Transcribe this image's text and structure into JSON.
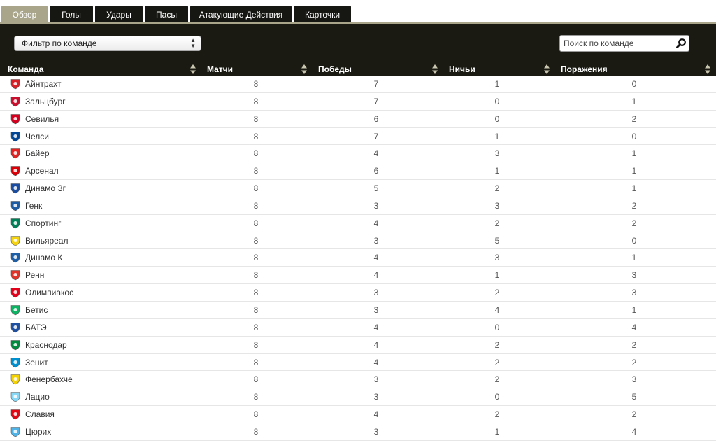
{
  "tabs": [
    {
      "label": "Обзор",
      "active": true
    },
    {
      "label": "Голы",
      "active": false
    },
    {
      "label": "Удары",
      "active": false
    },
    {
      "label": "Пасы",
      "active": false
    },
    {
      "label": "Атакующие Действия",
      "active": false
    },
    {
      "label": "Карточки",
      "active": false
    }
  ],
  "filter": {
    "label": "Фильтр по команде"
  },
  "search": {
    "placeholder": "Поиск по команде",
    "icon": "search-icon"
  },
  "columns": [
    "Команда",
    "Матчи",
    "Победы",
    "Ничьи",
    "Поражения"
  ],
  "colors": {
    "tab_active": "#a9a58a",
    "tab_bg": "#161612",
    "header_bg": "#1a1a12"
  },
  "rows": [
    {
      "team": "Айнтрахт",
      "matches": "8",
      "wins": "7",
      "draws": "1",
      "losses": "0",
      "crest_color": "#d81f26"
    },
    {
      "team": "Зальцбург",
      "matches": "8",
      "wins": "7",
      "draws": "0",
      "losses": "1",
      "crest_color": "#c8102e"
    },
    {
      "team": "Севилья",
      "matches": "8",
      "wins": "6",
      "draws": "0",
      "losses": "2",
      "crest_color": "#d5001f"
    },
    {
      "team": "Челси",
      "matches": "8",
      "wins": "7",
      "draws": "1",
      "losses": "0",
      "crest_color": "#034694"
    },
    {
      "team": "Байер",
      "matches": "8",
      "wins": "4",
      "draws": "3",
      "losses": "1",
      "crest_color": "#e32221"
    },
    {
      "team": "Арсенал",
      "matches": "8",
      "wins": "6",
      "draws": "1",
      "losses": "1",
      "crest_color": "#db0007"
    },
    {
      "team": "Динамо Зг",
      "matches": "8",
      "wins": "5",
      "draws": "2",
      "losses": "1",
      "crest_color": "#1a4da1"
    },
    {
      "team": "Генк",
      "matches": "8",
      "wins": "3",
      "draws": "3",
      "losses": "2",
      "crest_color": "#1d5ba4"
    },
    {
      "team": "Спортинг",
      "matches": "8",
      "wins": "4",
      "draws": "2",
      "losses": "2",
      "crest_color": "#008057"
    },
    {
      "team": "Вильяреал",
      "matches": "8",
      "wins": "3",
      "draws": "5",
      "losses": "0",
      "crest_color": "#f5d30f"
    },
    {
      "team": "Динамо К",
      "matches": "8",
      "wins": "4",
      "draws": "3",
      "losses": "1",
      "crest_color": "#1e5fa8"
    },
    {
      "team": "Ренн",
      "matches": "8",
      "wins": "4",
      "draws": "1",
      "losses": "3",
      "crest_color": "#e13327"
    },
    {
      "team": "Олимпиакос",
      "matches": "8",
      "wins": "3",
      "draws": "2",
      "losses": "3",
      "crest_color": "#e2001a"
    },
    {
      "team": "Бетис",
      "matches": "8",
      "wins": "3",
      "draws": "4",
      "losses": "1",
      "crest_color": "#0bb363"
    },
    {
      "team": "БАТЭ",
      "matches": "8",
      "wins": "4",
      "draws": "0",
      "losses": "4",
      "crest_color": "#1f4fa0"
    },
    {
      "team": "Краснодар",
      "matches": "8",
      "wins": "4",
      "draws": "2",
      "losses": "2",
      "crest_color": "#008a3e"
    },
    {
      "team": "Зенит",
      "matches": "8",
      "wins": "4",
      "draws": "2",
      "losses": "2",
      "crest_color": "#0090d0"
    },
    {
      "team": "Фенербахче",
      "matches": "8",
      "wins": "3",
      "draws": "2",
      "losses": "3",
      "crest_color": "#f4d200"
    },
    {
      "team": "Лацио",
      "matches": "8",
      "wins": "3",
      "draws": "0",
      "losses": "5",
      "crest_color": "#87d8f7"
    },
    {
      "team": "Славия",
      "matches": "8",
      "wins": "4",
      "draws": "2",
      "losses": "2",
      "crest_color": "#e30613"
    },
    {
      "team": "Цюрих",
      "matches": "8",
      "wins": "3",
      "draws": "1",
      "losses": "4",
      "crest_color": "#4fb3e8"
    }
  ]
}
